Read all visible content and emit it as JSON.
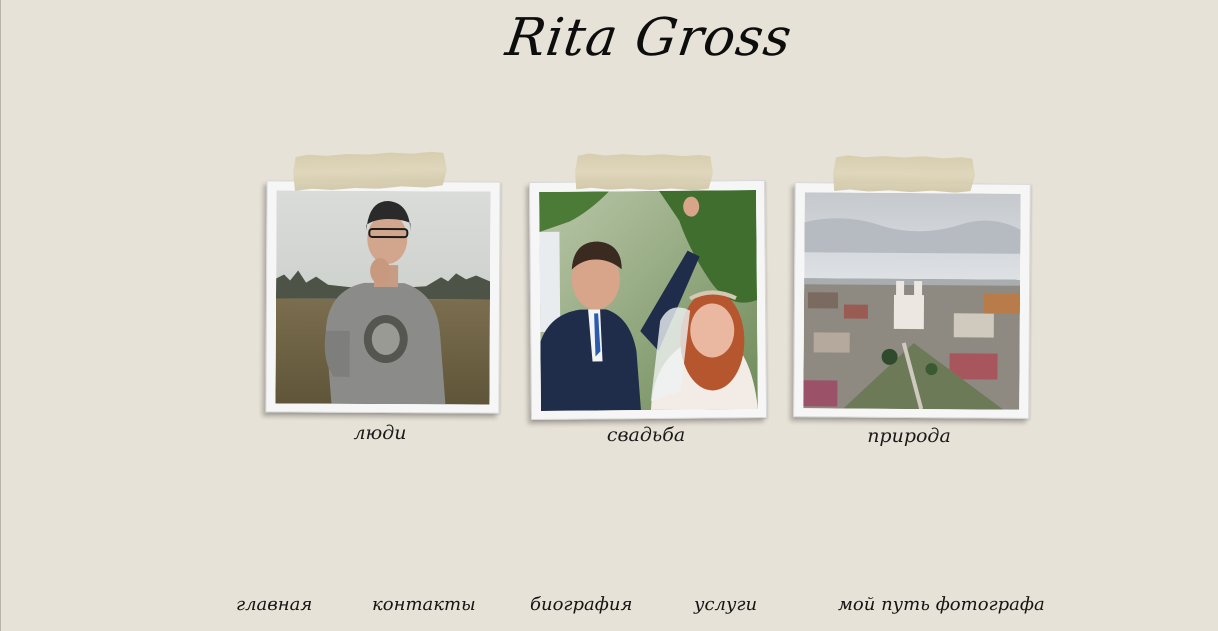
{
  "site": {
    "title": "Rita Gross"
  },
  "gallery": [
    {
      "id": "people",
      "caption": "люди"
    },
    {
      "id": "wedding",
      "caption": "свадьба"
    },
    {
      "id": "nature",
      "caption": "природа"
    }
  ],
  "nav": {
    "items": [
      {
        "label": "главная"
      },
      {
        "label": "контакты"
      },
      {
        "label": "биография"
      },
      {
        "label": "услуги"
      },
      {
        "label": "мой путь фотографа"
      }
    ]
  },
  "colors": {
    "background": "#e7e2d7",
    "tape": "#d6ccac",
    "frame": "#f6f6f6"
  },
  "icons": []
}
